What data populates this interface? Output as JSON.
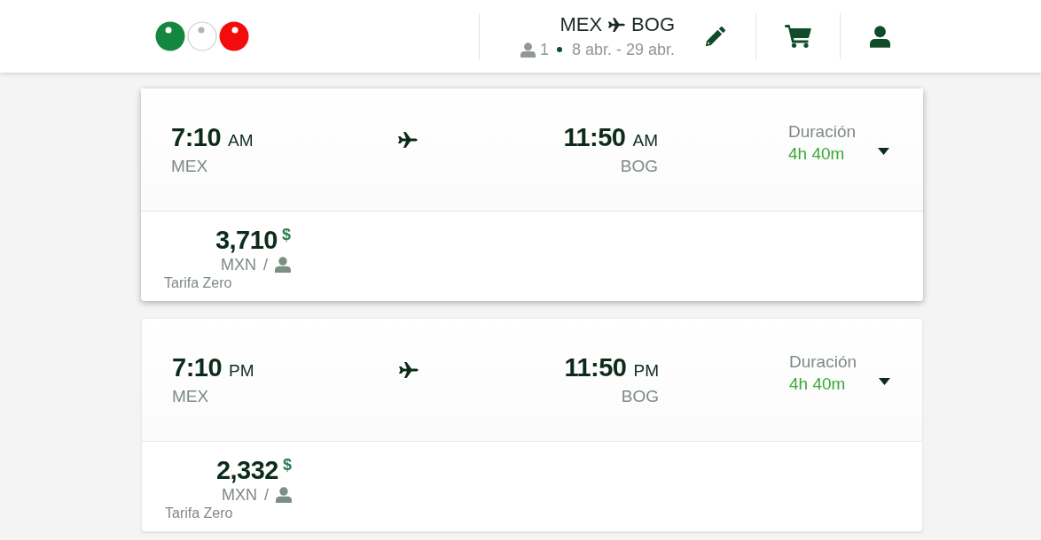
{
  "header": {
    "route": {
      "origin": "MEX",
      "destination": "BOG"
    },
    "passengers": "1",
    "dates": "8 abr. - 29 abr."
  },
  "flights": [
    {
      "elevated": true,
      "departure": {
        "time": "7:10",
        "period": "AM",
        "airport": "MEX"
      },
      "arrival": {
        "time": "11:50",
        "period": "AM",
        "airport": "BOG"
      },
      "duration_label": "Duración",
      "duration": "4h 40m",
      "expanded": false,
      "price": "3,710",
      "currency_symbol": "$",
      "currency": "MXN",
      "per": "/",
      "fare": "Tarifa Zero"
    },
    {
      "elevated": false,
      "departure": {
        "time": "7:10",
        "period": "PM",
        "airport": "MEX"
      },
      "arrival": {
        "time": "11:50",
        "period": "PM",
        "airport": "BOG"
      },
      "duration_label": "Duración",
      "duration": "4h 40m",
      "expanded": false,
      "price": "2,332",
      "currency_symbol": "$",
      "currency": "MXN",
      "per": "/",
      "fare": "Tarifa Zero"
    }
  ]
}
